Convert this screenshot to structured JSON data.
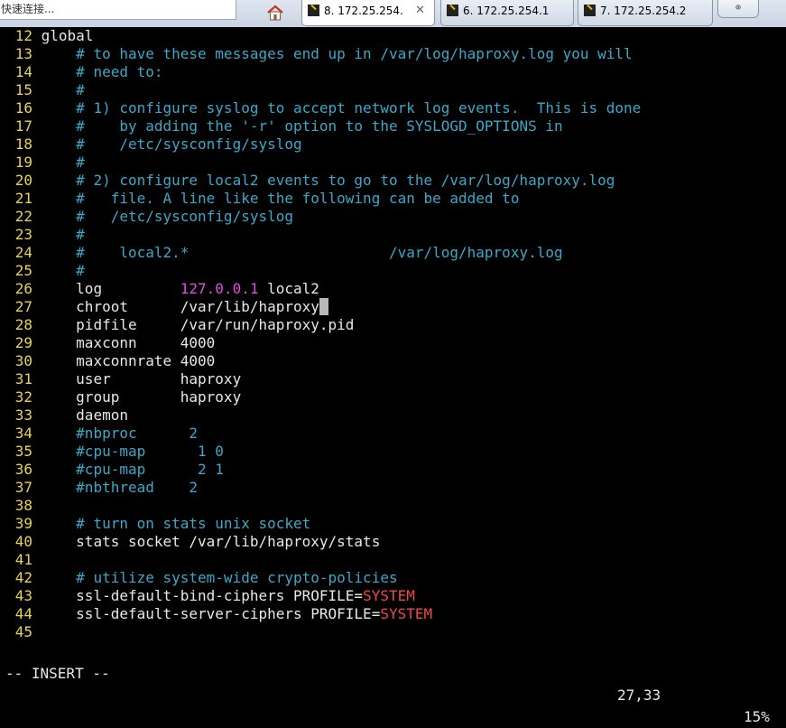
{
  "tabbar": {
    "quick_connect": "快速连接...",
    "tabs": [
      {
        "label": "8. 172.25.254.",
        "active": true
      },
      {
        "label": "6. 172.25.254.1",
        "active": false
      },
      {
        "label": "7. 172.25.254.2",
        "active": false
      }
    ],
    "home_icon": "home-icon",
    "new_tab_icon": "new-tab-icon"
  },
  "editor": {
    "lines": [
      {
        "n": "12",
        "segs": [
          {
            "t": "global",
            "c": "txt"
          }
        ]
      },
      {
        "n": "13",
        "segs": [
          {
            "t": "    ",
            "c": "txt"
          },
          {
            "t": "# to have these messages end up in /var/log/haproxy.log you will",
            "c": "cmt"
          }
        ]
      },
      {
        "n": "14",
        "segs": [
          {
            "t": "    ",
            "c": "txt"
          },
          {
            "t": "# need to:",
            "c": "cmt"
          }
        ]
      },
      {
        "n": "15",
        "segs": [
          {
            "t": "    ",
            "c": "txt"
          },
          {
            "t": "#",
            "c": "cmt"
          }
        ]
      },
      {
        "n": "16",
        "segs": [
          {
            "t": "    ",
            "c": "txt"
          },
          {
            "t": "# 1) configure syslog to accept network log events.  This is done",
            "c": "cmt"
          }
        ]
      },
      {
        "n": "17",
        "segs": [
          {
            "t": "    ",
            "c": "txt"
          },
          {
            "t": "#    by adding the '-r' option to the SYSLOGD_OPTIONS in",
            "c": "cmt"
          }
        ]
      },
      {
        "n": "18",
        "segs": [
          {
            "t": "    ",
            "c": "txt"
          },
          {
            "t": "#    /etc/sysconfig/syslog",
            "c": "cmt"
          }
        ]
      },
      {
        "n": "19",
        "segs": [
          {
            "t": "    ",
            "c": "txt"
          },
          {
            "t": "#",
            "c": "cmt"
          }
        ]
      },
      {
        "n": "20",
        "segs": [
          {
            "t": "    ",
            "c": "txt"
          },
          {
            "t": "# 2) configure local2 events to go to the /var/log/haproxy.log",
            "c": "cmt"
          }
        ]
      },
      {
        "n": "21",
        "segs": [
          {
            "t": "    ",
            "c": "txt"
          },
          {
            "t": "#   file. A line like the following can be added to",
            "c": "cmt"
          }
        ]
      },
      {
        "n": "22",
        "segs": [
          {
            "t": "    ",
            "c": "txt"
          },
          {
            "t": "#   /etc/sysconfig/syslog",
            "c": "cmt"
          }
        ]
      },
      {
        "n": "23",
        "segs": [
          {
            "t": "    ",
            "c": "txt"
          },
          {
            "t": "#",
            "c": "cmt"
          }
        ]
      },
      {
        "n": "24",
        "segs": [
          {
            "t": "    ",
            "c": "txt"
          },
          {
            "t": "#    local2.*                       /var/log/haproxy.log",
            "c": "cmt"
          }
        ]
      },
      {
        "n": "25",
        "segs": [
          {
            "t": "    ",
            "c": "txt"
          },
          {
            "t": "#",
            "c": "cmt"
          }
        ]
      },
      {
        "n": "26",
        "segs": [
          {
            "t": "    log         ",
            "c": "txt"
          },
          {
            "t": "127.0.0.1",
            "c": "ip"
          },
          {
            "t": " local2",
            "c": "txt"
          }
        ]
      },
      {
        "n": "27",
        "segs": [
          {
            "t": "    chroot      /var/lib/haproxy",
            "c": "txt"
          },
          {
            "t": " ",
            "c": "cursor"
          }
        ]
      },
      {
        "n": "28",
        "segs": [
          {
            "t": "    pidfile     /var/run/haproxy.pid",
            "c": "txt"
          }
        ]
      },
      {
        "n": "29",
        "segs": [
          {
            "t": "    maxconn     4000",
            "c": "txt"
          }
        ]
      },
      {
        "n": "30",
        "segs": [
          {
            "t": "    maxconnrate 4000",
            "c": "txt"
          }
        ]
      },
      {
        "n": "31",
        "segs": [
          {
            "t": "    user        haproxy",
            "c": "txt"
          }
        ]
      },
      {
        "n": "32",
        "segs": [
          {
            "t": "    group       haproxy",
            "c": "txt"
          }
        ]
      },
      {
        "n": "33",
        "segs": [
          {
            "t": "    daemon",
            "c": "txt"
          }
        ]
      },
      {
        "n": "34",
        "segs": [
          {
            "t": "    ",
            "c": "txt"
          },
          {
            "t": "#nbproc      2",
            "c": "cmt"
          }
        ]
      },
      {
        "n": "35",
        "segs": [
          {
            "t": "    ",
            "c": "txt"
          },
          {
            "t": "#cpu-map      1 0",
            "c": "cmt"
          }
        ]
      },
      {
        "n": "36",
        "segs": [
          {
            "t": "    ",
            "c": "txt"
          },
          {
            "t": "#cpu-map      2 1",
            "c": "cmt"
          }
        ]
      },
      {
        "n": "37",
        "segs": [
          {
            "t": "    ",
            "c": "txt"
          },
          {
            "t": "#nbthread    2",
            "c": "cmt"
          }
        ]
      },
      {
        "n": "38",
        "segs": []
      },
      {
        "n": "39",
        "segs": [
          {
            "t": "    ",
            "c": "txt"
          },
          {
            "t": "# turn on stats unix socket",
            "c": "cmt"
          }
        ]
      },
      {
        "n": "40",
        "segs": [
          {
            "t": "    stats socket /var/lib/haproxy/stats",
            "c": "txt"
          }
        ]
      },
      {
        "n": "41",
        "segs": []
      },
      {
        "n": "42",
        "segs": [
          {
            "t": "    ",
            "c": "txt"
          },
          {
            "t": "# utilize system-wide crypto-policies",
            "c": "cmt"
          }
        ]
      },
      {
        "n": "43",
        "segs": [
          {
            "t": "    ssl-default-bind-ciphers PROFILE=",
            "c": "txt"
          },
          {
            "t": "SYSTEM",
            "c": "sys"
          }
        ]
      },
      {
        "n": "44",
        "segs": [
          {
            "t": "    ssl-default-server-ciphers PROFILE=",
            "c": "txt"
          },
          {
            "t": "SYSTEM",
            "c": "sys"
          }
        ]
      },
      {
        "n": "45",
        "segs": []
      }
    ]
  },
  "statusbar": {
    "mode": "-- INSERT --",
    "position": "27,33",
    "percent": "15%"
  },
  "colors": {
    "line_number": "#e8d44d",
    "comment": "#3aa9c9",
    "ip": "#e04ce0",
    "keyword_system": "#f04848",
    "text": "#e8e8e8"
  }
}
